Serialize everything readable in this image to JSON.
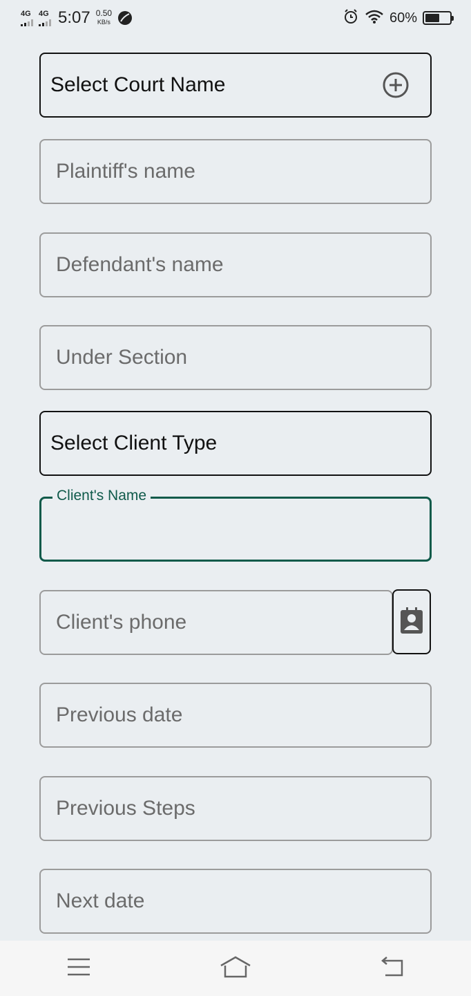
{
  "status_bar": {
    "net1": "4G",
    "net2": "4G",
    "time": "5:07",
    "speed_value": "0.50",
    "speed_unit": "KB/s",
    "battery_percent": "60%",
    "battery_level": 0.6,
    "icons": [
      "leaf-icon",
      "alarm-icon",
      "wifi-icon",
      "battery-icon"
    ]
  },
  "form": {
    "court": {
      "label": "Select Court Name",
      "icon": "add-circle-icon"
    },
    "plaintiff": {
      "placeholder": "Plaintiff's name"
    },
    "defendant": {
      "placeholder": "Defendant's name"
    },
    "under_section": {
      "placeholder": "Under Section"
    },
    "client_type": {
      "label": "Select Client Type"
    },
    "client_name": {
      "label": "Client's Name",
      "value": ""
    },
    "client_phone": {
      "placeholder": "Client's phone",
      "icon": "contact-picker-icon"
    },
    "previous_date": {
      "placeholder": "Previous date"
    },
    "previous_steps": {
      "placeholder": "Previous Steps"
    },
    "next_date": {
      "placeholder": "Next date"
    }
  },
  "nav_bar": {
    "icons": [
      "menu-icon",
      "home-icon",
      "back-icon"
    ]
  },
  "colors": {
    "background": "#eaeef1",
    "accent": "#0f5a4a",
    "border": "#9b9b9b"
  }
}
